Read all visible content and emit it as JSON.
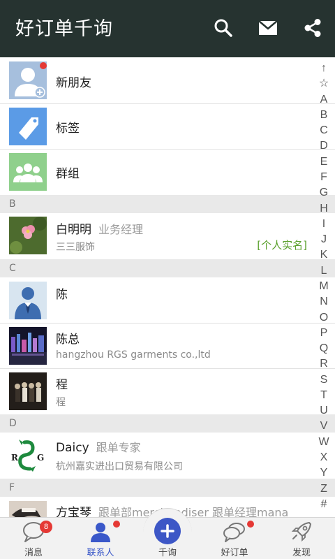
{
  "header": {
    "title": "好订单千询",
    "icons": [
      "search-icon",
      "mail-icon",
      "share-icon"
    ]
  },
  "quick": [
    {
      "label": "新朋友",
      "icon": "add-person-icon",
      "badge": true
    },
    {
      "label": "标签",
      "icon": "tag-icon"
    },
    {
      "label": "群组",
      "icon": "group-icon"
    }
  ],
  "sections": {
    "b": "B",
    "c": "C",
    "d": "D",
    "f": "F"
  },
  "contacts": {
    "baimingming": {
      "name": "白明明",
      "role": "业务经理",
      "sub": "三三服饰",
      "tag": "[个人实名]"
    },
    "chen": {
      "name": "陈"
    },
    "chenzong": {
      "name": "陈总",
      "sub": "hangzhou RGS garments co.,ltd"
    },
    "cheng": {
      "name": "程",
      "sub": "程"
    },
    "daicy": {
      "name": "Daicy",
      "role": "跟单专家",
      "sub": "杭州嘉实进出口贸易有限公司"
    },
    "fangbaoqin": {
      "name": "方宝琴",
      "role": "跟单部merchendiser 跟单经理mana"
    }
  },
  "index": [
    "↑",
    "☆",
    "A",
    "B",
    "C",
    "D",
    "E",
    "F",
    "G",
    "H",
    "I",
    "J",
    "K",
    "L",
    "M",
    "N",
    "O",
    "P",
    "Q",
    "R",
    "S",
    "T",
    "U",
    "V",
    "W",
    "X",
    "Y",
    "Z",
    "#"
  ],
  "nav": {
    "messages": {
      "label": "消息",
      "badge": "8"
    },
    "contacts": {
      "label": "联系人"
    },
    "ask": {
      "label": "千询"
    },
    "orders": {
      "label": "好订单"
    },
    "discover": {
      "label": "发现"
    }
  },
  "colors": {
    "header_bg": "#263330",
    "accent": "#3d57c6",
    "verified_tag": "#5aa02c",
    "badge": "#e53935"
  }
}
